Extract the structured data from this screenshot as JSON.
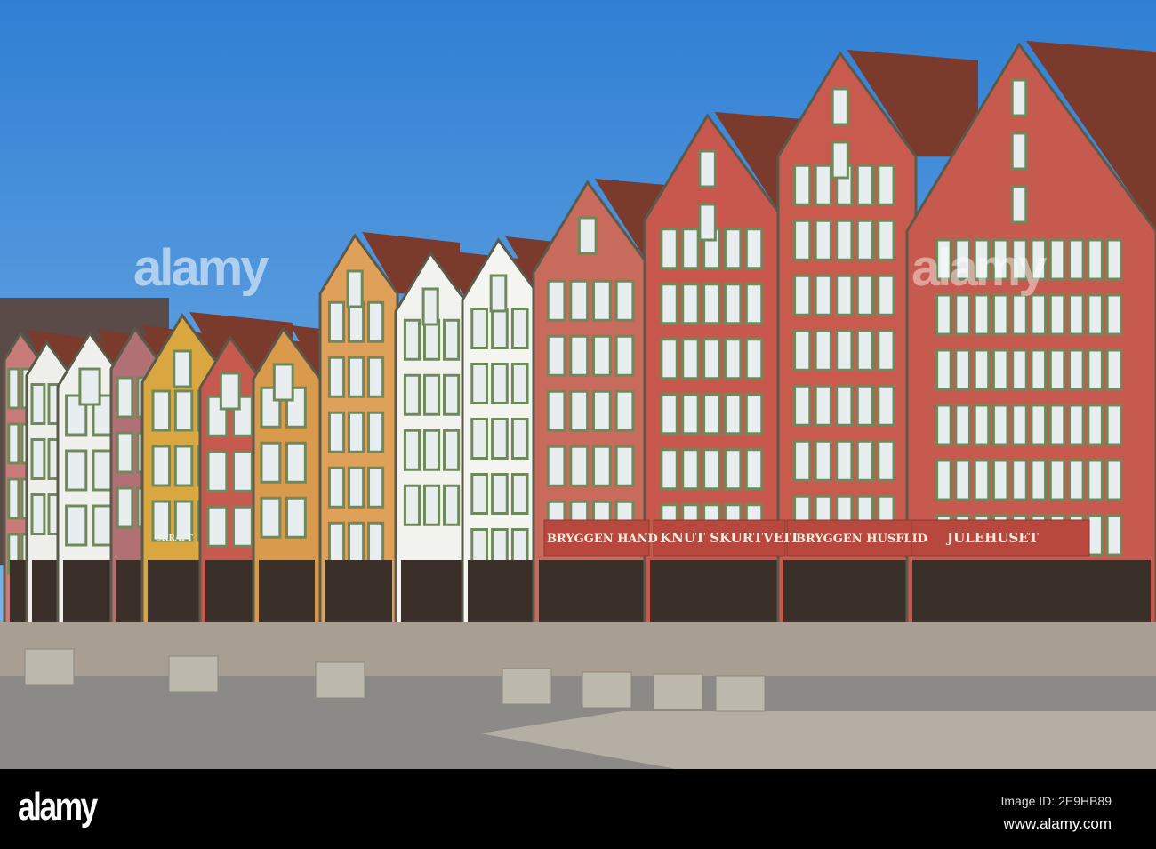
{
  "signs": {
    "bryggen_hand": "BRYGGEN  HAND",
    "knut_skurtveit": "KNUT SKURTVEIT",
    "bryggen_husflid": "BRYGGEN HUSFLID",
    "julehuset": "JULEHUSET",
    "skrift": "SKRAFT"
  },
  "watermark": {
    "text": "alamy"
  },
  "footer": {
    "logo": "alamy",
    "image_id": "Image ID: 2E9HB89",
    "website": "www.alamy.com"
  },
  "colors": {
    "sky": "#3a86d6",
    "red_house": "#c8584d",
    "yellow_house": "#d9a640",
    "white_house": "#f2f2ee",
    "roof": "#7a3a2c"
  }
}
